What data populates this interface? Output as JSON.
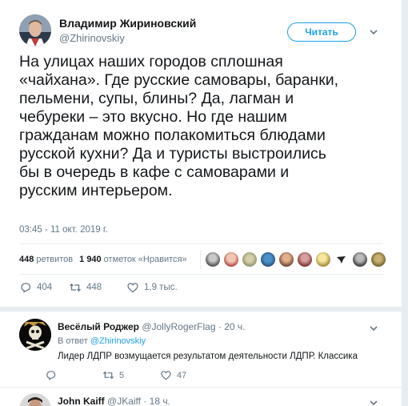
{
  "tweet": {
    "author_name": "Владимир Жириновский",
    "author_handle": "@Zhirinovskiy",
    "follow_label": "Читать",
    "text": "На улицах наших городов сплошная\n«чайхана». Где русские самовары, баранки,\nпельмени, супы, блины? Да, лагман и\nчебуреки – это вкусно. Но где нашим\nгражданам можно полакомиться блюдами\nрусской кухни? Да и туристы выстроились\nбы в очередь в кафе с самоварами и\nрусским интерьером.",
    "timestamp": "03:45 - 11 окт. 2019 г.",
    "retweets_count": "448",
    "retweets_label": "ретвитов",
    "likes_count": "1 940",
    "likes_label": "отметок «Нравится»",
    "actions": {
      "reply": "404",
      "retweet": "448",
      "like": "1,9 тыс."
    }
  },
  "replies": [
    {
      "name": "Весёлый Роджер",
      "handle": "@JollyRogerFlag · 20 ч.",
      "in_reply_prefix": "В ответ",
      "in_reply_handle": "@Zhirinovskiy",
      "text": "Лидер ЛДПР возмущается результатом деятельности ЛДПР. Классика",
      "retweets": "5",
      "likes": "47"
    },
    {
      "name": "John Kaiff",
      "handle": "@JKaiff · 18 ч."
    }
  ],
  "colors": {
    "accent": "#1da1f2",
    "text": "#14171a",
    "muted": "#657786",
    "divider": "#e6ecf0"
  },
  "icons": [
    "chevron-down-icon",
    "reply-icon",
    "retweet-icon",
    "like-icon"
  ]
}
